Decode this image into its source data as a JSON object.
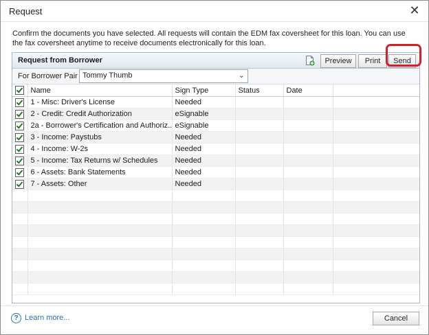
{
  "dialog": {
    "title": "Request",
    "close_glyph": "✕",
    "intro": "Confirm the documents you have selected. All requests will contain the EDM fax coversheet for this loan. You can use the fax coversheet anytime to receive documents electronically for this loan."
  },
  "panel": {
    "title": "Request from Borrower",
    "doc_icon": "add-document-icon",
    "buttons": {
      "preview": "Preview",
      "print": "Print",
      "send": "Send"
    },
    "highlight_color": "#d0202a"
  },
  "pair": {
    "label": "For Borrower Pair",
    "value": "Tommy Thumb"
  },
  "table": {
    "header_checked": true,
    "columns": [
      "Name",
      "Sign Type",
      "Status",
      "Date"
    ],
    "rows": [
      {
        "checked": true,
        "name": "1 - Misc: Driver's License",
        "sign_type": "Needed",
        "status": "",
        "date": ""
      },
      {
        "checked": true,
        "name": "2 - Credit: Credit Authorization",
        "sign_type": "eSignable",
        "status": "",
        "date": ""
      },
      {
        "checked": true,
        "name": "2a - Borrower's Certification and Authoriz...",
        "sign_type": "eSignable",
        "status": "",
        "date": ""
      },
      {
        "checked": true,
        "name": "3 - Income: Paystubs",
        "sign_type": "Needed",
        "status": "",
        "date": ""
      },
      {
        "checked": true,
        "name": "4 - Income: W-2s",
        "sign_type": "Needed",
        "status": "",
        "date": ""
      },
      {
        "checked": true,
        "name": "5 - Income: Tax Returns w/ Schedules",
        "sign_type": "Needed",
        "status": "",
        "date": ""
      },
      {
        "checked": true,
        "name": "6 - Assets: Bank Statements",
        "sign_type": "Needed",
        "status": "",
        "date": ""
      },
      {
        "checked": true,
        "name": "7 - Assets: Other",
        "sign_type": "Needed",
        "status": "",
        "date": ""
      }
    ]
  },
  "footer": {
    "learn_more": "Learn more...",
    "help_glyph": "?",
    "cancel": "Cancel"
  }
}
